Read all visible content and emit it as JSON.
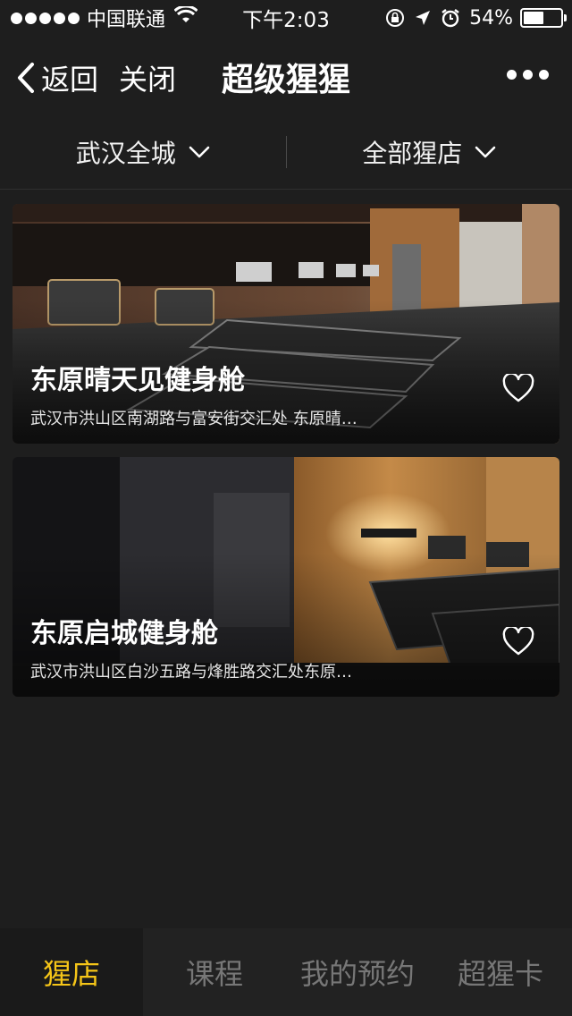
{
  "status_bar": {
    "carrier": "中国联通",
    "time": "下午2:03",
    "battery": "54%",
    "battery_level": 0.54
  },
  "nav": {
    "back_label": "返回",
    "close_label": "关闭",
    "title": "超级猩猩"
  },
  "filters": {
    "city": "武汉全城",
    "store": "全部猩店"
  },
  "stores": [
    {
      "name": "东原晴天见健身舱",
      "address": "武汉市洪山区南湖路与富安街交汇处 东原晴…"
    },
    {
      "name": "东原启城健身舱",
      "address": "武汉市洪山区白沙五路与烽胜路交汇处东原…"
    }
  ],
  "tabs": [
    {
      "label": "猩店",
      "active": true
    },
    {
      "label": "课程",
      "active": false
    },
    {
      "label": "我的预约",
      "active": false
    },
    {
      "label": "超猩卡",
      "active": false
    }
  ],
  "colors": {
    "background": "#1e1e1e",
    "active_tab": "#f5c518",
    "inactive_tab": "#777777"
  }
}
